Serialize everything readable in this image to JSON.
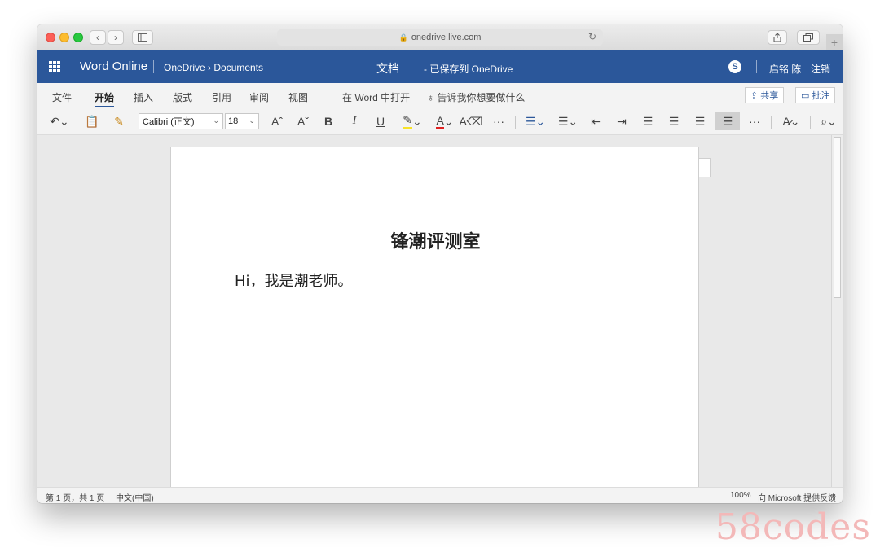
{
  "browser": {
    "url": "onedrive.live.com",
    "lock_icon": "lock-icon",
    "reload_icon": "reload-icon",
    "back": "‹",
    "forward": "›",
    "sidebar_icon": "sidebar-icon",
    "share_icon": "share-icon",
    "tabs_icon": "tabs-icon",
    "new_tab": "+"
  },
  "header": {
    "app_name": "Word Online",
    "breadcrumb": "OneDrive › Documents",
    "doc_title": "文档",
    "save_status": "-  已保存到 OneDrive",
    "skype": "S",
    "user": "启铭 陈",
    "signout": "注销",
    "color": "#2b579a"
  },
  "menu": {
    "items": [
      "文件",
      "开始",
      "插入",
      "版式",
      "引用",
      "审阅",
      "视图",
      "在 Word 中打开"
    ],
    "tell_me": "告诉我你想要做什么",
    "active": "开始",
    "share": "共享",
    "comment": "批注"
  },
  "toolbar": {
    "font": "Calibri (正文)",
    "size": "18",
    "bold": "B",
    "italic": "I",
    "underline": "U",
    "grow": "Aˆ",
    "shrink": "Aˇ",
    "font_color": "A",
    "more": "···"
  },
  "document": {
    "heading": "锋潮评测室",
    "body": "Hi，我是潮老师。"
  },
  "status": {
    "pages": "第 1 页，共 1 页",
    "language": "中文(中国)",
    "zoom": "100%",
    "feedback": "向 Microsoft 提供反馈"
  },
  "watermark": "58codes"
}
